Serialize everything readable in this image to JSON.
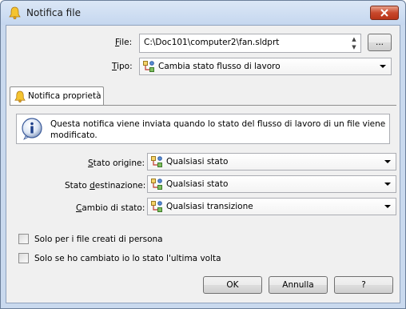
{
  "window": {
    "title": "Notifica file"
  },
  "form": {
    "file_label_pre": "",
    "file_label_u": "F",
    "file_label_post": "ile:",
    "file_value": "C:\\Doc101\\computer2\\fan.sldprt",
    "browse_label": "...",
    "type_label_u": "T",
    "type_label_post": "ipo:",
    "type_value": "Cambia stato flusso di lavoro"
  },
  "tab": {
    "label": "Notifica proprietà"
  },
  "info": {
    "text": "Questa notifica viene inviata quando lo stato del flusso di lavoro di un file viene modificato."
  },
  "fields": {
    "origin_label_pre": "",
    "origin_label_u": "S",
    "origin_label_post": "tato origine:",
    "origin_value": "Qualsiasi stato",
    "dest_label_pre": "Stato ",
    "dest_label_u": "d",
    "dest_label_post": "estinazione:",
    "dest_value": "Qualsiasi stato",
    "change_label_pre": "",
    "change_label_u": "C",
    "change_label_post": "ambio di stato:",
    "change_value": "Qualsiasi transizione"
  },
  "checkboxes": {
    "self_created": "Solo per i file creati di persona",
    "self_changed": "Solo se ho cambiato io lo stato l'ultima volta"
  },
  "buttons": {
    "ok": "OK",
    "cancel": "Annulla",
    "help": "?"
  }
}
